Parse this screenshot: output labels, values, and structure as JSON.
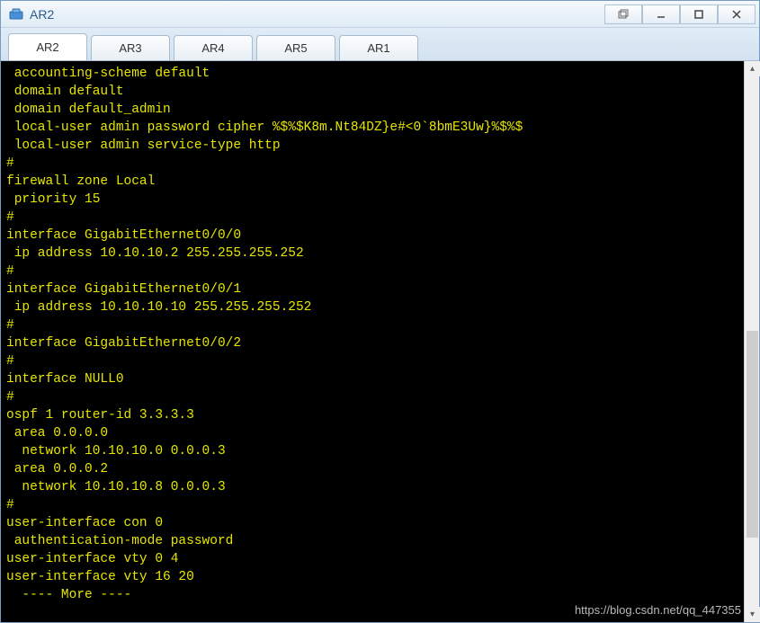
{
  "window": {
    "title": "AR2"
  },
  "tabs": [
    {
      "label": "AR2",
      "active": true
    },
    {
      "label": "AR3",
      "active": false
    },
    {
      "label": "AR4",
      "active": false
    },
    {
      "label": "AR5",
      "active": false
    },
    {
      "label": "AR1",
      "active": false
    }
  ],
  "terminal": {
    "lines": [
      " accounting-scheme default",
      " domain default",
      " domain default_admin",
      " local-user admin password cipher %$%$K8m.Nt84DZ}e#<0`8bmE3Uw}%$%$",
      " local-user admin service-type http",
      "#",
      "firewall zone Local",
      " priority 15",
      "#",
      "interface GigabitEthernet0/0/0",
      " ip address 10.10.10.2 255.255.255.252",
      "#",
      "interface GigabitEthernet0/0/1",
      " ip address 10.10.10.10 255.255.255.252",
      "#",
      "interface GigabitEthernet0/0/2",
      "#",
      "interface NULL0",
      "#",
      "ospf 1 router-id 3.3.3.3",
      " area 0.0.0.0",
      "  network 10.10.10.0 0.0.0.3",
      " area 0.0.0.2",
      "  network 10.10.10.8 0.0.0.3",
      "#",
      "user-interface con 0",
      " authentication-mode password",
      "user-interface vty 0 4",
      "user-interface vty 16 20",
      "  ---- More ----"
    ]
  },
  "watermark": "https://blog.csdn.net/qq_447355"
}
